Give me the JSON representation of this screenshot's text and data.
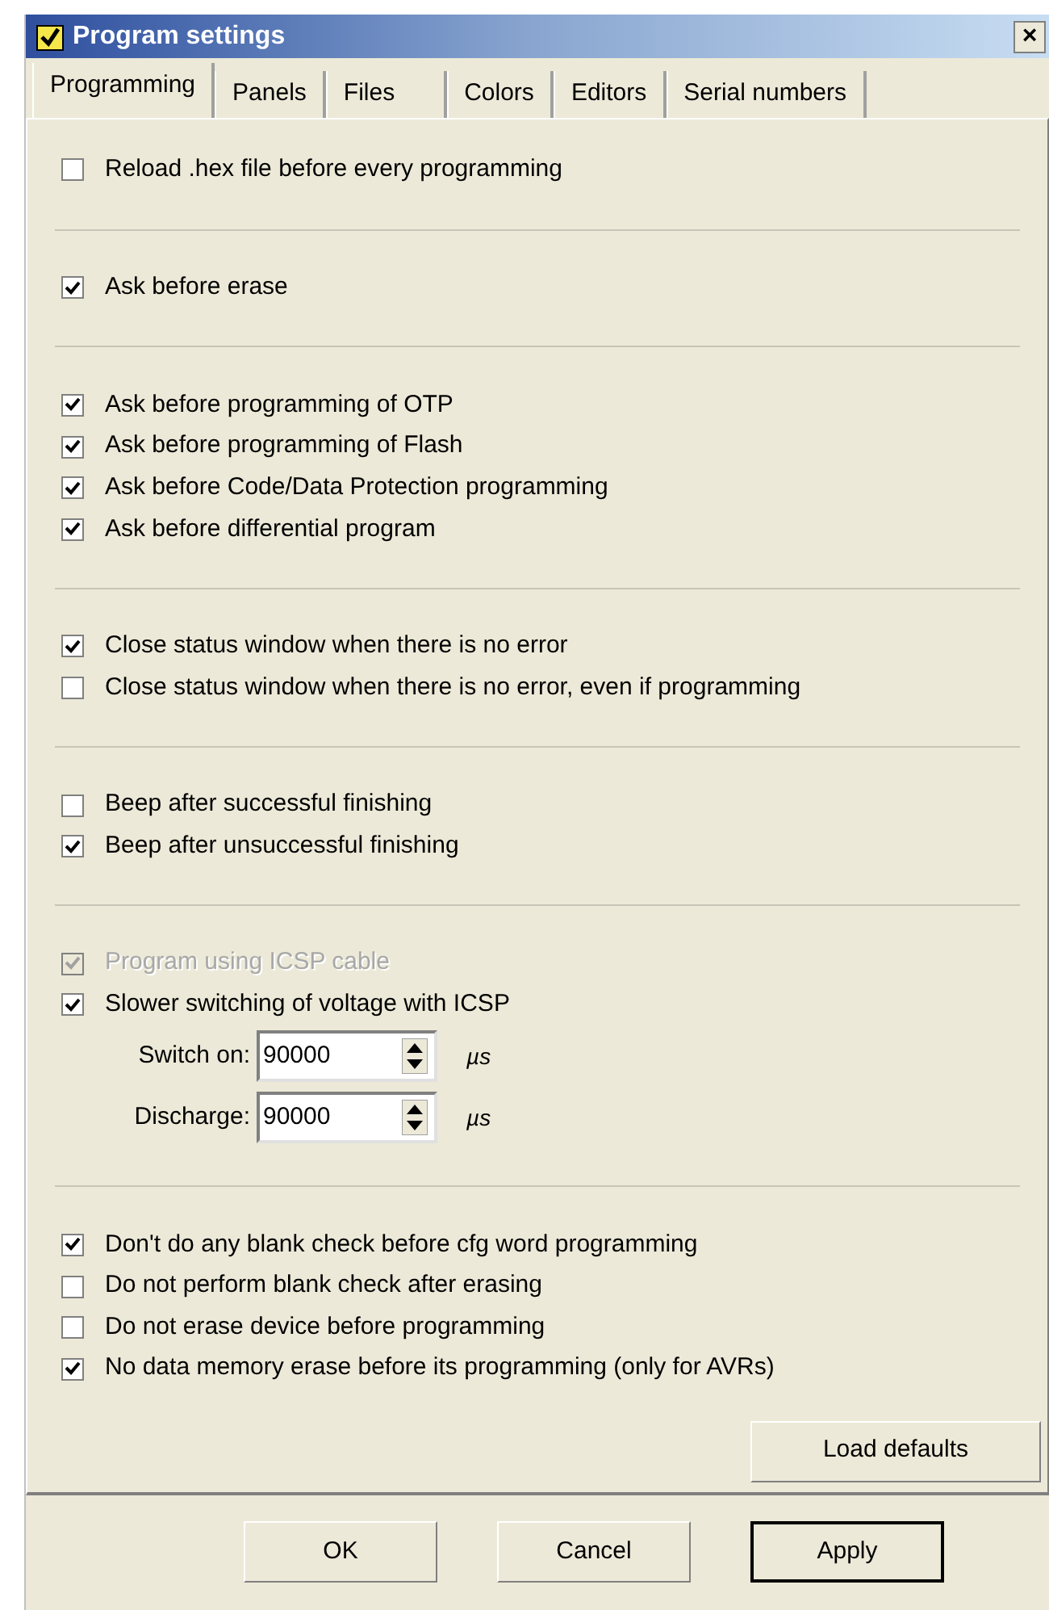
{
  "window": {
    "title": "Program settings",
    "close": "×"
  },
  "tabs": [
    {
      "label": "Programming",
      "selected": true
    },
    {
      "label": "Panels",
      "selected": false
    },
    {
      "label": "Files",
      "selected": false
    },
    {
      "label": "Colors",
      "selected": false
    },
    {
      "label": "Editors",
      "selected": false
    },
    {
      "label": "Serial numbers",
      "selected": false
    }
  ],
  "groups": [
    {
      "items": [
        {
          "kind": "checkbox",
          "label": "Reload .hex file before every programming",
          "checked": false,
          "disabled": false
        }
      ]
    },
    {
      "items": [
        {
          "kind": "checkbox",
          "label": "Ask before erase",
          "checked": true,
          "disabled": false
        }
      ]
    },
    {
      "items": [
        {
          "kind": "checkbox",
          "label": "Ask before programming of OTP",
          "checked": true,
          "disabled": false
        },
        {
          "kind": "checkbox",
          "label": "Ask before programming of Flash",
          "checked": true,
          "disabled": false
        },
        {
          "kind": "checkbox",
          "label": "Ask before Code/Data Protection programming",
          "checked": true,
          "disabled": false
        },
        {
          "kind": "checkbox",
          "label": "Ask before differential program",
          "checked": true,
          "disabled": false
        }
      ]
    },
    {
      "items": [
        {
          "kind": "checkbox",
          "label": "Close status window when there is no error",
          "checked": true,
          "disabled": false
        },
        {
          "kind": "checkbox",
          "label": "Close status window when there is no error, even if programming",
          "checked": false,
          "disabled": false
        }
      ]
    },
    {
      "items": [
        {
          "kind": "checkbox",
          "label": "Beep after successful finishing",
          "checked": false,
          "disabled": false
        },
        {
          "kind": "checkbox",
          "label": "Beep after unsuccessful finishing",
          "checked": true,
          "disabled": false
        }
      ]
    },
    {
      "items": [
        {
          "kind": "checkbox",
          "label": "Program using ICSP cable",
          "checked": true,
          "disabled": true
        },
        {
          "kind": "checkbox",
          "label": "Slower switching of voltage with ICSP",
          "checked": true,
          "disabled": false
        },
        {
          "kind": "spin",
          "label": "Switch on:",
          "value": "90000",
          "unit": "µs"
        },
        {
          "kind": "spin",
          "label": "Discharge:",
          "value": "90000",
          "unit": "µs"
        }
      ]
    },
    {
      "items": [
        {
          "kind": "checkbox",
          "label": "Don't do any blank check before cfg word programming",
          "checked": true,
          "disabled": false
        },
        {
          "kind": "checkbox",
          "label": "Do not perform blank check after erasing",
          "checked": false,
          "disabled": false
        },
        {
          "kind": "checkbox",
          "label": "Do not erase device before programming",
          "checked": false,
          "disabled": false
        },
        {
          "kind": "checkbox",
          "label": "No data memory erase before its programming (only for AVRs)",
          "checked": true,
          "disabled": false
        }
      ]
    }
  ],
  "load_defaults": "Load defaults",
  "buttons": [
    {
      "label": "OK",
      "default": false
    },
    {
      "label": "Cancel",
      "default": false
    },
    {
      "label": "Apply",
      "default": true
    }
  ]
}
